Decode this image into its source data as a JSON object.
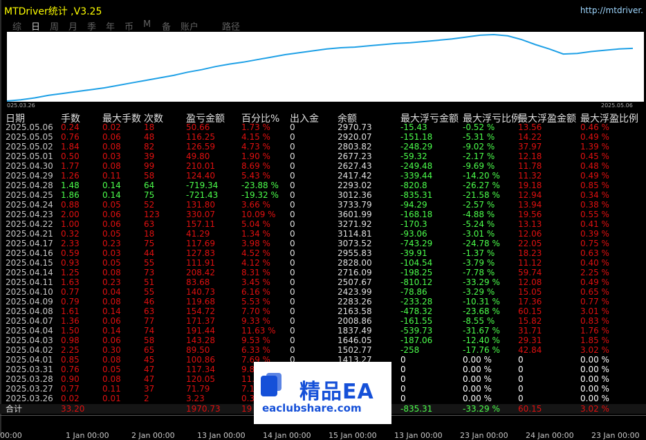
{
  "window": {
    "title": "MTDriver统计 ,V3.25",
    "url": "http://mtdriver."
  },
  "tabs": [
    {
      "label": "综",
      "active": false
    },
    {
      "label": "日",
      "active": true
    },
    {
      "label": "周",
      "active": false
    },
    {
      "label": "月",
      "active": false
    },
    {
      "label": "季",
      "active": false
    },
    {
      "label": "年",
      "active": false
    },
    {
      "label": "币",
      "active": false
    },
    {
      "label": "M",
      "active": false
    },
    {
      "label": "备",
      "active": false
    },
    {
      "label": "账户",
      "active": false
    },
    {
      "label": "路径",
      "active": false
    }
  ],
  "equity_chart": {
    "start_label": "025.03.26",
    "end_label": "2025.05.06",
    "line_color": "#1ea0e6",
    "values": [
      0,
      0.02,
      0.05,
      0.09,
      0.12,
      0.15,
      0.18,
      0.21,
      0.25,
      0.29,
      0.33,
      0.37,
      0.41,
      0.46,
      0.5,
      0.55,
      0.59,
      0.62,
      0.66,
      0.7,
      0.74,
      0.77,
      0.8,
      0.83,
      0.85,
      0.86,
      0.88,
      0.9,
      0.92,
      0.93,
      0.95,
      0.97,
      0.99,
      1.02,
      1.05,
      1.06,
      1.04,
      0.98,
      0.9,
      0.83,
      0.75,
      0.76,
      0.79,
      0.81,
      0.83,
      0.84
    ]
  },
  "columns": [
    "日期",
    "手数",
    "最大手数",
    "次数",
    "盈亏金额",
    "百分比%",
    "出入金",
    "余额",
    "最大浮亏金额",
    "最大浮亏比例",
    "最大浮盈金额",
    "最大浮盈比例"
  ],
  "rows": [
    {
      "date": "2025.05.06",
      "lots": "0.24",
      "maxlot": "0.02",
      "count": "18",
      "pnl": "50.66",
      "pct": "1.73 %",
      "dep": "0",
      "bal": "2970.73",
      "mfl": "-15.43",
      "mflp": "-0.52 %",
      "mfp": "13.56",
      "mfpp": "0.46 %",
      "win": false
    },
    {
      "date": "2025.05.05",
      "lots": "0.76",
      "maxlot": "0.06",
      "count": "48",
      "pnl": "116.25",
      "pct": "4.15 %",
      "dep": "0",
      "bal": "2920.07",
      "mfl": "-151.18",
      "mflp": "-5.31 %",
      "mfp": "14.22",
      "mfpp": "0.49 %",
      "win": false
    },
    {
      "date": "2025.05.02",
      "lots": "1.84",
      "maxlot": "0.08",
      "count": "82",
      "pnl": "126.59",
      "pct": "4.73 %",
      "dep": "0",
      "bal": "2803.82",
      "mfl": "-248.29",
      "mflp": "-9.02 %",
      "mfp": "37.97",
      "mfpp": "1.39 %",
      "win": false
    },
    {
      "date": "2025.05.01",
      "lots": "0.50",
      "maxlot": "0.03",
      "count": "39",
      "pnl": "49.80",
      "pct": "1.90 %",
      "dep": "0",
      "bal": "2677.23",
      "mfl": "-59.32",
      "mflp": "-2.17 %",
      "mfp": "12.18",
      "mfpp": "0.45 %",
      "win": false
    },
    {
      "date": "2025.04.30",
      "lots": "1.77",
      "maxlot": "0.08",
      "count": "99",
      "pnl": "210.01",
      "pct": "8.69 %",
      "dep": "0",
      "bal": "2627.43",
      "mfl": "-249.48",
      "mflp": "-9.69 %",
      "mfp": "11.78",
      "mfpp": "0.48 %",
      "win": false
    },
    {
      "date": "2025.04.29",
      "lots": "1.26",
      "maxlot": "0.11",
      "count": "58",
      "pnl": "124.40",
      "pct": "5.43 %",
      "dep": "0",
      "bal": "2417.42",
      "mfl": "-339.44",
      "mflp": "-14.20 %",
      "mfp": "11.32",
      "mfpp": "0.49 %",
      "win": false
    },
    {
      "date": "2025.04.28",
      "lots": "1.48",
      "maxlot": "0.14",
      "count": "64",
      "pnl": "-719.34",
      "pct": "-23.88 %",
      "dep": "0",
      "bal": "2293.02",
      "mfl": "-820.8",
      "mflp": "-26.27 %",
      "mfp": "19.18",
      "mfpp": "0.85 %",
      "win": true
    },
    {
      "date": "2025.04.25",
      "lots": "1.86",
      "maxlot": "0.14",
      "count": "75",
      "pnl": "-721.43",
      "pct": "-19.32 %",
      "dep": "0",
      "bal": "3012.36",
      "mfl": "-835.31",
      "mflp": "-21.58 %",
      "mfp": "12.94",
      "mfpp": "0.34 %",
      "win": true
    },
    {
      "date": "2025.04.24",
      "lots": "0.88",
      "maxlot": "0.05",
      "count": "52",
      "pnl": "131.80",
      "pct": "3.66 %",
      "dep": "0",
      "bal": "3733.79",
      "mfl": "-94.29",
      "mflp": "-2.57 %",
      "mfp": "13.94",
      "mfpp": "0.38 %",
      "win": false
    },
    {
      "date": "2025.04.23",
      "lots": "2.00",
      "maxlot": "0.06",
      "count": "123",
      "pnl": "330.07",
      "pct": "10.09 %",
      "dep": "0",
      "bal": "3601.99",
      "mfl": "-168.18",
      "mflp": "-4.88 %",
      "mfp": "19.56",
      "mfpp": "0.55 %",
      "win": false
    },
    {
      "date": "2025.04.22",
      "lots": "1.00",
      "maxlot": "0.06",
      "count": "63",
      "pnl": "157.11",
      "pct": "5.04 %",
      "dep": "0",
      "bal": "3271.92",
      "mfl": "-170.3",
      "mflp": "-5.24 %",
      "mfp": "13.13",
      "mfpp": "0.41 %",
      "win": false
    },
    {
      "date": "2025.04.21",
      "lots": "0.32",
      "maxlot": "0.05",
      "count": "18",
      "pnl": "41.29",
      "pct": "1.34 %",
      "dep": "0",
      "bal": "3114.81",
      "mfl": "-93.06",
      "mflp": "-3.01 %",
      "mfp": "12.06",
      "mfpp": "0.39 %",
      "win": false
    },
    {
      "date": "2025.04.17",
      "lots": "2.33",
      "maxlot": "0.23",
      "count": "75",
      "pnl": "117.69",
      "pct": "3.98 %",
      "dep": "0",
      "bal": "3073.52",
      "mfl": "-743.29",
      "mflp": "-24.78 %",
      "mfp": "22.05",
      "mfpp": "0.75 %",
      "win": false
    },
    {
      "date": "2025.04.16",
      "lots": "0.59",
      "maxlot": "0.03",
      "count": "44",
      "pnl": "127.83",
      "pct": "4.52 %",
      "dep": "0",
      "bal": "2955.83",
      "mfl": "-39.91",
      "mflp": "-1.37 %",
      "mfp": "18.23",
      "mfpp": "0.63 %",
      "win": false
    },
    {
      "date": "2025.04.15",
      "lots": "0.93",
      "maxlot": "0.05",
      "count": "55",
      "pnl": "111.91",
      "pct": "4.12 %",
      "dep": "0",
      "bal": "2828.00",
      "mfl": "-104.54",
      "mflp": "-3.79 %",
      "mfp": "11.12",
      "mfpp": "0.40 %",
      "win": false
    },
    {
      "date": "2025.04.14",
      "lots": "1.25",
      "maxlot": "0.08",
      "count": "73",
      "pnl": "208.42",
      "pct": "8.31 %",
      "dep": "0",
      "bal": "2716.09",
      "mfl": "-198.25",
      "mflp": "-7.78 %",
      "mfp": "59.74",
      "mfpp": "2.25 %",
      "win": false
    },
    {
      "date": "2025.04.11",
      "lots": "1.63",
      "maxlot": "0.23",
      "count": "51",
      "pnl": "83.68",
      "pct": "3.45 %",
      "dep": "0",
      "bal": "2507.67",
      "mfl": "-810.12",
      "mflp": "-33.29 %",
      "mfp": "12.08",
      "mfpp": "0.49 %",
      "win": false
    },
    {
      "date": "2025.04.10",
      "lots": "0.77",
      "maxlot": "0.04",
      "count": "55",
      "pnl": "140.73",
      "pct": "6.16 %",
      "dep": "0",
      "bal": "2423.99",
      "mfl": "-78.86",
      "mflp": "-3.29 %",
      "mfp": "15.05",
      "mfpp": "0.65 %",
      "win": false
    },
    {
      "date": "2025.04.09",
      "lots": "0.79",
      "maxlot": "0.08",
      "count": "46",
      "pnl": "119.68",
      "pct": "5.53 %",
      "dep": "0",
      "bal": "2283.26",
      "mfl": "-233.28",
      "mflp": "-10.31 %",
      "mfp": "17.36",
      "mfpp": "0.77 %",
      "win": false
    },
    {
      "date": "2025.04.08",
      "lots": "1.61",
      "maxlot": "0.14",
      "count": "63",
      "pnl": "154.72",
      "pct": "7.70 %",
      "dep": "0",
      "bal": "2163.58",
      "mfl": "-478.32",
      "mflp": "-23.68 %",
      "mfp": "60.15",
      "mfpp": "3.01 %",
      "win": false
    },
    {
      "date": "2025.04.07",
      "lots": "1.36",
      "maxlot": "0.06",
      "count": "77",
      "pnl": "171.37",
      "pct": "9.33 %",
      "dep": "0",
      "bal": "2008.86",
      "mfl": "-161.55",
      "mflp": "-8.55 %",
      "mfp": "15.82",
      "mfpp": "0.83 %",
      "win": false
    },
    {
      "date": "2025.04.04",
      "lots": "1.50",
      "maxlot": "0.14",
      "count": "74",
      "pnl": "191.44",
      "pct": "11.63 %",
      "dep": "0",
      "bal": "1837.49",
      "mfl": "-539.73",
      "mflp": "-31.67 %",
      "mfp": "31.71",
      "mfpp": "1.76 %",
      "win": false
    },
    {
      "date": "2025.04.03",
      "lots": "0.98",
      "maxlot": "0.06",
      "count": "58",
      "pnl": "143.28",
      "pct": "9.53 %",
      "dep": "0",
      "bal": "1646.05",
      "mfl": "-187.06",
      "mflp": "-12.40 %",
      "mfp": "29.31",
      "mfpp": "1.85 %",
      "win": false
    },
    {
      "date": "2025.04.02",
      "lots": "2.25",
      "maxlot": "0.30",
      "count": "65",
      "pnl": "89.50",
      "pct": "6.33 %",
      "dep": "0",
      "bal": "1502.77",
      "mfl": "-258",
      "mflp": "-17.76 %",
      "mfp": "42.84",
      "mfpp": "3.02 %",
      "win": false
    },
    {
      "date": "2025.04.01",
      "lots": "0.85",
      "maxlot": "0.08",
      "count": "45",
      "pnl": "100.86",
      "pct": "7.69 %",
      "dep": "0",
      "bal": "1413.27",
      "mfl": "0",
      "mflp": "0.00 %",
      "mfp": "0",
      "mfpp": "0.00 %",
      "win": false,
      "zero": true
    },
    {
      "date": "2025.03.31",
      "lots": "0.76",
      "maxlot": "0.05",
      "count": "47",
      "pnl": "117.34",
      "pct": "9.8",
      "dep": "",
      "bal": "",
      "mfl": "0",
      "mflp": "0.00 %",
      "mfp": "0",
      "mfpp": "0.00 %",
      "win": false,
      "zero": true
    },
    {
      "date": "2025.03.28",
      "lots": "0.90",
      "maxlot": "0.08",
      "count": "47",
      "pnl": "120.05",
      "pct": "11.",
      "dep": "",
      "bal": "",
      "mfl": "0",
      "mflp": "0.00 %",
      "mfp": "0",
      "mfpp": "0.00 %",
      "win": false,
      "zero": true
    },
    {
      "date": "2025.03.27",
      "lots": "0.77",
      "maxlot": "0.11",
      "count": "37",
      "pnl": "71.79",
      "pct": "7.1",
      "dep": "",
      "bal": "",
      "mfl": "0",
      "mflp": "0.00 %",
      "mfp": "0",
      "mfpp": "0.00 %",
      "win": false,
      "zero": true
    },
    {
      "date": "2025.03.26",
      "lots": "0.02",
      "maxlot": "0.01",
      "count": "2",
      "pnl": "3.23",
      "pct": "0.3",
      "dep": "",
      "bal": "",
      "mfl": "0",
      "mflp": "0.00 %",
      "mfp": "0",
      "mfpp": "0.00 %",
      "win": false,
      "zero": true
    }
  ],
  "summary": {
    "label": "合计",
    "lots": "33.20",
    "pnl": "1970.73",
    "pct": "19",
    "mfl": "-835.31",
    "mflp": "-33.29 %",
    "mfp": "60.15",
    "mfpp": "3.02 %"
  },
  "axis_ticks": [
    "00:00",
    "1 Jan 00:00",
    "2 Jan 00:00",
    "13 Jan 00:00",
    "14 Jan 00:00",
    "15 Jan 00:00",
    "13 Jan 00:00",
    "23 Jan 00:00",
    "24 Jan 00:00",
    "23 Jan 00:00"
  ],
  "watermark": {
    "brand": "精品EA",
    "domain": "eaclubshare.com"
  }
}
